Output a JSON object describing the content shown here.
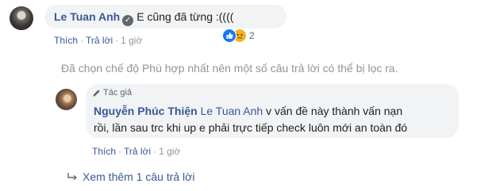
{
  "comment": {
    "author": "Le Tuan Anh",
    "text": "E cũng đã từng :((((",
    "actions": {
      "like": "Thích",
      "reply": "Trả lời",
      "time": "1 giờ"
    },
    "reactions": {
      "count": "2",
      "icons": [
        "like-icon",
        "sad-icon"
      ]
    }
  },
  "filter_note": "Đã chọn chế độ Phù hợp nhất nên một số câu trả lời có thể bị lọc ra.",
  "reply": {
    "badge": "Tác giả",
    "author": "Nguyễn Phúc Thiện",
    "mention": "Le Tuan Anh",
    "text_line1": "v vấn đề này thành vấn nạn",
    "text_line2": "rồi, lần sau trc khi up e phải trực tiếp check luôn mới an toàn đó",
    "actions": {
      "like": "Thích",
      "reply": "Trả lời",
      "time": "1 giờ"
    }
  },
  "more_replies": "Xem thêm 1 câu trả lời",
  "colors": {
    "link": "#385898",
    "bubble": "#f2f3f5",
    "muted": "#90949c"
  }
}
